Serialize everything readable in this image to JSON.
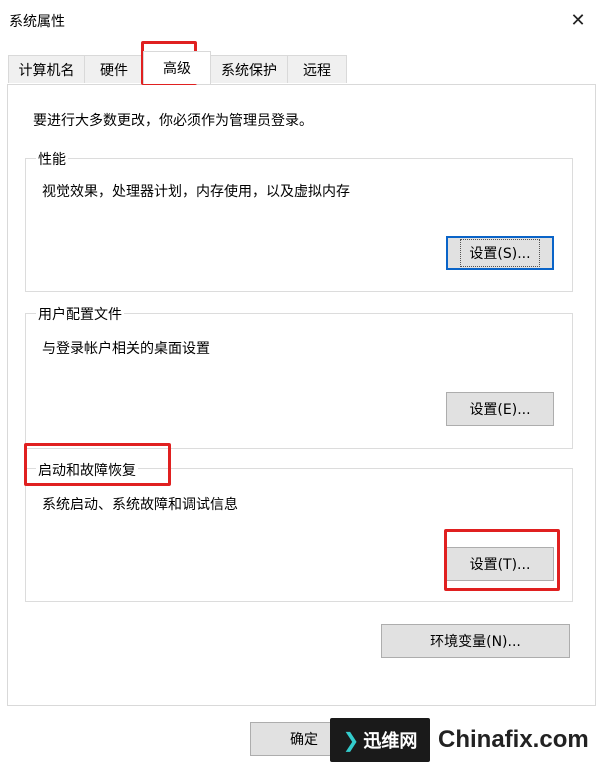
{
  "window": {
    "title": "系统属性",
    "close_glyph": "✕"
  },
  "tabs": [
    {
      "label": "计算机名"
    },
    {
      "label": "硬件"
    },
    {
      "label": "高级"
    },
    {
      "label": "系统保护"
    },
    {
      "label": "远程"
    }
  ],
  "active_tab": "高级",
  "admin_note": "要进行大多数更改，你必须作为管理员登录。",
  "performance": {
    "legend": "性能",
    "description": "视觉效果，处理器计划，内存使用，以及虚拟内存",
    "button": "设置(S)..."
  },
  "user_profiles": {
    "legend": "用户配置文件",
    "description": "与登录帐户相关的桌面设置",
    "button": "设置(E)..."
  },
  "startup_recovery": {
    "legend": "启动和故障恢复",
    "description": "系统启动、系统故障和调试信息",
    "button": "设置(T)..."
  },
  "env_button": "环境变量(N)...",
  "footer": {
    "ok_button": "确定"
  },
  "watermark": {
    "logo_text": "迅维网",
    "site_text": "Chinafix.com"
  },
  "colors": {
    "highlight_red": "#e02020",
    "focus_blue": "#0a64c8"
  }
}
